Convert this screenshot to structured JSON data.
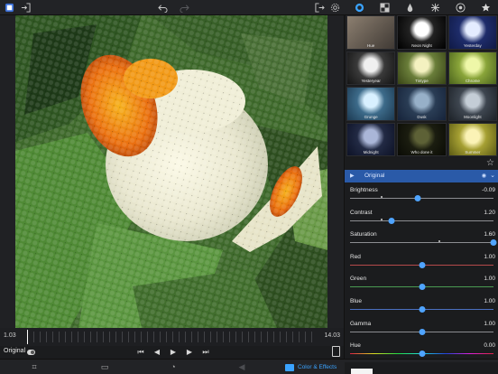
{
  "toolbar": {
    "icons": [
      "app-icon",
      "import-icon",
      "undo-icon",
      "redo-icon",
      "export-icon",
      "settings-icon",
      "effects-icon",
      "texture-icon",
      "drop-icon",
      "sparkle-icon",
      "aperture-icon",
      "favorites-icon"
    ]
  },
  "timeline": {
    "start": "1.03",
    "end": "14.03"
  },
  "playback": {
    "original_label": "Original",
    "buttons": [
      "skip-start-icon",
      "step-back-icon",
      "play-icon",
      "step-forward-icon",
      "skip-end-icon"
    ]
  },
  "tabs": {
    "active_label": "Color & Effects"
  },
  "presets": [
    {
      "name": "Hue"
    },
    {
      "name": "Neon Night"
    },
    {
      "name": "Yesterday"
    },
    {
      "name": "Yesteryear"
    },
    {
      "name": "Tintype"
    },
    {
      "name": "Chrome"
    },
    {
      "name": "Grunge"
    },
    {
      "name": "Dusk"
    },
    {
      "name": "Moonlight"
    },
    {
      "name": "Midnight"
    },
    {
      "name": "Who done it"
    },
    {
      "name": "Summer"
    }
  ],
  "layer": {
    "name": "Original"
  },
  "adjustments": [
    {
      "label": "Brightness",
      "value": "-0.09",
      "level": 0.47
    },
    {
      "label": "Contrast",
      "value": "1.20",
      "level": 0.29
    },
    {
      "label": "Saturation",
      "value": "1.60",
      "level": 1.0
    },
    {
      "label": "Red",
      "value": "1.00",
      "level": 0.5
    },
    {
      "label": "Green",
      "value": "1.00",
      "level": 0.5
    },
    {
      "label": "Blue",
      "value": "1.00",
      "level": 0.5
    },
    {
      "label": "Gamma",
      "value": "1.00",
      "level": 0.5
    },
    {
      "label": "Hue",
      "value": "0.00",
      "level": 0.5
    }
  ],
  "colors": {
    "accent": "#3aa3ff",
    "layer_row": "#2a5aa8"
  }
}
